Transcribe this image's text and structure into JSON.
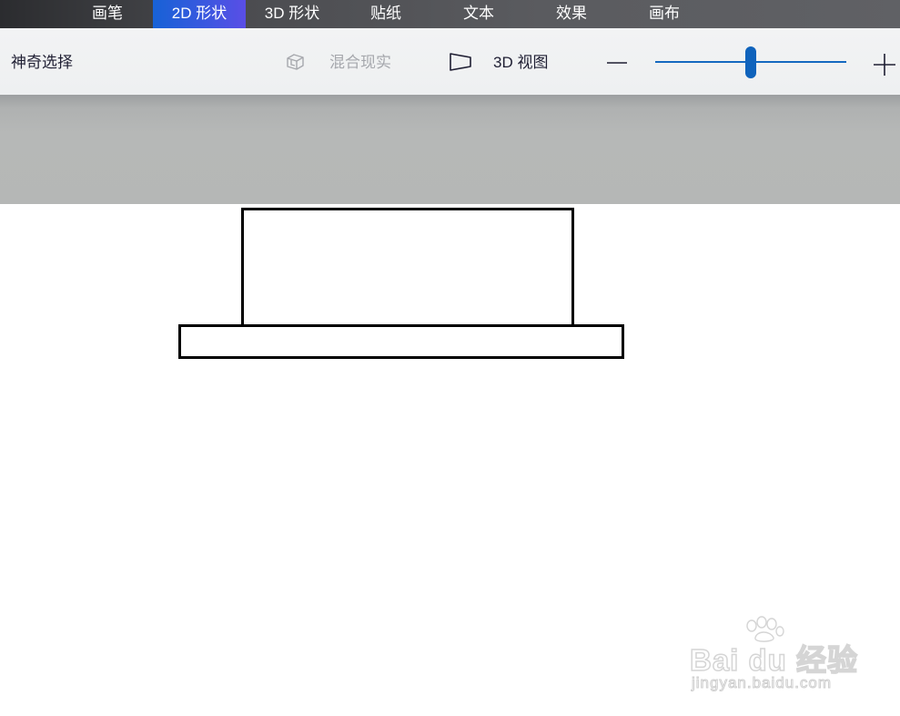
{
  "menu": {
    "tabs": [
      {
        "label": "画笔",
        "active": false
      },
      {
        "label": "2D 形状",
        "active": true
      },
      {
        "label": "3D 形状",
        "active": false
      },
      {
        "label": "贴纸",
        "active": false
      },
      {
        "label": "文本",
        "active": false
      },
      {
        "label": "效果",
        "active": false
      },
      {
        "label": "画布",
        "active": false
      }
    ]
  },
  "toolbar": {
    "magic_select_label": "神奇选择",
    "mixed_reality_label": "混合现实",
    "view_3d_label": "3D 视图",
    "zoom_level_fraction": 0.5
  },
  "watermark": {
    "brand": "Bai du 经验",
    "url": "jingyan.baidu.com"
  },
  "colors": {
    "accent": "#1762d6",
    "slider": "#1569c0",
    "shape_stroke": "#000000",
    "backdrop": "#b5b7b6"
  }
}
